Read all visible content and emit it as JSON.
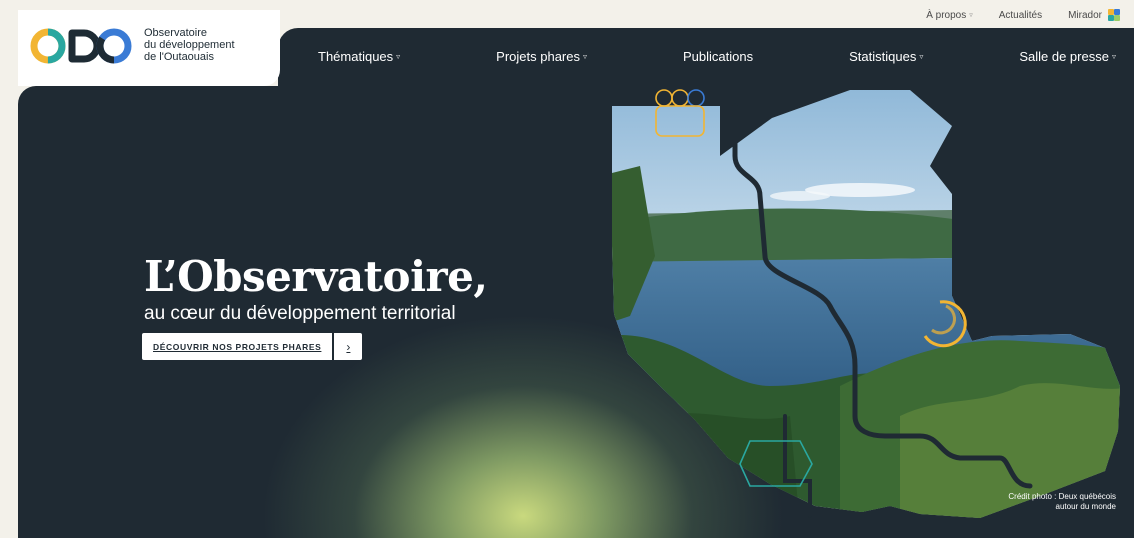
{
  "top_links": [
    {
      "label": "À propos",
      "has_dropdown": true
    },
    {
      "label": "Actualités",
      "has_dropdown": false
    },
    {
      "label": "Mirador",
      "has_dropdown": false
    }
  ],
  "logo": {
    "mark": "ODO",
    "line1": "Observatoire",
    "line2": "du développement",
    "line3": "de l'Outaouais"
  },
  "nav": [
    {
      "label": "Thématiques",
      "has_dropdown": true
    },
    {
      "label": "Projets phares",
      "has_dropdown": true
    },
    {
      "label": "Publications",
      "has_dropdown": false
    },
    {
      "label": "Statistiques",
      "has_dropdown": true
    },
    {
      "label": "Salle de presse",
      "has_dropdown": true
    }
  ],
  "hero": {
    "title": "L’Observatoire,",
    "subtitle": "au cœur du développement territorial",
    "cta_label": "DÉCOUVRIR NOS PROJETS PHARES",
    "cta_arrow": "›"
  },
  "credit": {
    "line1": "Crédit photo : Deux québécois",
    "line2": "autour du monde"
  },
  "colors": {
    "hero_bg": "#1f2a33",
    "accent_yellow": "#f2b533",
    "accent_teal": "#2aa7a0",
    "accent_blue": "#3a7bd5",
    "glow": "#c9d97e"
  },
  "icons": {
    "dropdown": "chevron-down-icon",
    "cta_arrow": "chevron-right-icon",
    "mirador": "mirador-icon"
  }
}
